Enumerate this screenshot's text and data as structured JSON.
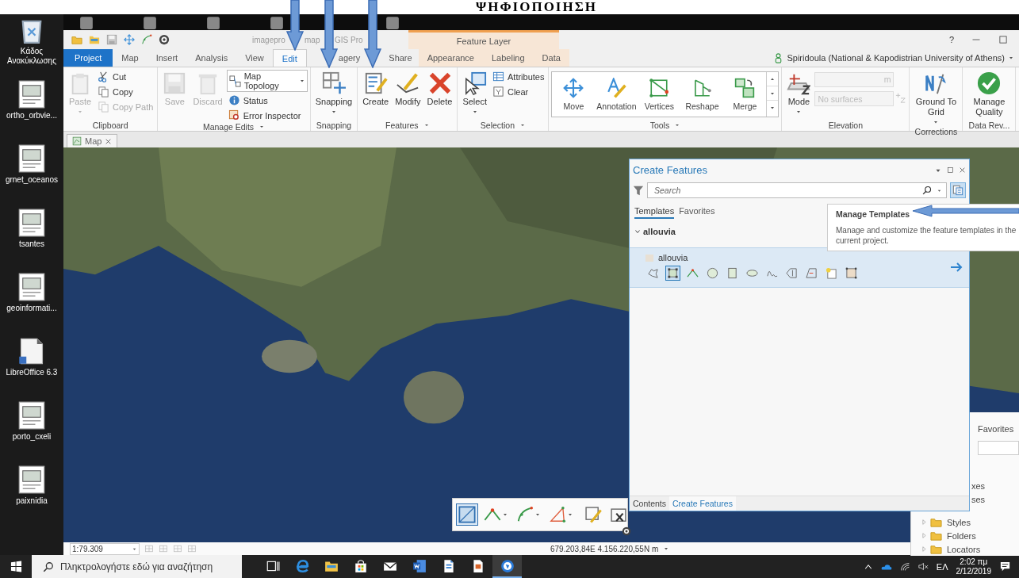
{
  "slide_title": "ΨΗΦΙΟΠΟΙΗΣΗ",
  "desktop_icons": [
    {
      "label": "Κάδος Ανακύκλωσης"
    },
    {
      "label": "ortho_orbvie..."
    },
    {
      "label": "grnet_oceanos"
    },
    {
      "label": "tsantes"
    },
    {
      "label": "geoinformati..."
    },
    {
      "label": "LibreOffice 6.3"
    },
    {
      "label": "porto_cxeli"
    },
    {
      "label": "paixnidia"
    }
  ],
  "app": {
    "title_fragments": [
      "imagepro",
      "map",
      "GIS Pro"
    ],
    "contextual_tab_group": "Feature Layer",
    "tabs": [
      {
        "label": "Project",
        "kind": "backstage",
        "selected": false
      },
      {
        "label": "Map",
        "kind": "core",
        "selected": false
      },
      {
        "label": "Insert",
        "kind": "core",
        "selected": false
      },
      {
        "label": "Analysis",
        "kind": "core",
        "selected": false
      },
      {
        "label": "View",
        "kind": "core",
        "selected": false
      },
      {
        "label": "Edit",
        "kind": "core",
        "selected": true
      },
      {
        "label": "agery",
        "kind": "core",
        "selected": false
      },
      {
        "label": "Share",
        "kind": "core",
        "selected": false
      },
      {
        "label": "Appearance",
        "kind": "contextual",
        "selected": false
      },
      {
        "label": "Labeling",
        "kind": "contextual",
        "selected": false
      },
      {
        "label": "Data",
        "kind": "contextual",
        "selected": false
      }
    ],
    "help": "?",
    "user": "Spiridoula (National & Kapodistrian University of Athens)",
    "ribbon": [
      {
        "label": "Clipboard",
        "launcher": false,
        "items": [
          {
            "kind": "large-menu",
            "label": "Paste",
            "disabled": true
          },
          {
            "kind": "small",
            "label": "Cut",
            "disabled": false
          },
          {
            "kind": "small",
            "label": "Copy",
            "disabled": false
          },
          {
            "kind": "small",
            "label": "Copy Path",
            "disabled": true
          }
        ]
      },
      {
        "label": "Manage Edits",
        "launcher": true,
        "items": [
          {
            "kind": "large",
            "label": "Save",
            "disabled": true
          },
          {
            "kind": "large",
            "label": "Discard",
            "disabled": true
          },
          {
            "kind": "combo",
            "label": "Map Topology",
            "disabled": false
          },
          {
            "kind": "small",
            "label": "Status",
            "disabled": false
          },
          {
            "kind": "small",
            "label": "Error Inspector",
            "disabled": false
          }
        ]
      },
      {
        "label": "Snapping",
        "launcher": false,
        "items": [
          {
            "kind": "large-menu",
            "label": "Snapping",
            "disabled": false
          }
        ]
      },
      {
        "label": "Features",
        "launcher": true,
        "items": [
          {
            "kind": "large",
            "label": "Create",
            "disabled": false
          },
          {
            "kind": "large",
            "label": "Modify",
            "disabled": false
          },
          {
            "kind": "large",
            "label": "Delete",
            "disabled": false
          }
        ]
      },
      {
        "label": "Selection",
        "launcher": true,
        "items": [
          {
            "kind": "large-menu",
            "label": "Select",
            "disabled": false
          },
          {
            "kind": "small",
            "label": "Attributes",
            "disabled": false
          },
          {
            "kind": "small",
            "label": "Clear",
            "disabled": false
          }
        ]
      },
      {
        "label": "Tools",
        "launcher": true,
        "items": [
          {
            "kind": "gallery",
            "disabled": false,
            "tools": [
              "Move",
              "Annotation",
              "Vertices",
              "Reshape",
              "Merge"
            ]
          }
        ]
      },
      {
        "label": "Elevation",
        "launcher": false,
        "items": [
          {
            "kind": "large-menu",
            "label": "Mode",
            "disabled": false
          },
          {
            "kind": "field",
            "unit": "m",
            "disabled": true
          },
          {
            "kind": "field",
            "placeholder": "No surfaces",
            "disabled": true
          }
        ]
      },
      {
        "label": "Corrections",
        "launcher": false,
        "items": [
          {
            "kind": "large-inline-menu",
            "label": "Ground To Grid",
            "disabled": false
          }
        ]
      },
      {
        "label": "Data Rev...",
        "launcher": false,
        "items": [
          {
            "kind": "large",
            "label": "Manage Quality",
            "disabled": false
          }
        ]
      }
    ],
    "document_tabs": [
      {
        "label": "Map",
        "selected": true
      }
    ],
    "create_features": {
      "title": "Create Features",
      "search_placeholder": "Search",
      "tabs": [
        {
          "label": "Templates",
          "selected": true
        },
        {
          "label": "Favorites",
          "selected": false
        }
      ],
      "groups": [
        {
          "name": "allouvia",
          "expanded": true,
          "templates": [
            {
              "name": "allouvia",
              "selected": true,
              "tools": [
                {
                  "selected": false
                },
                {
                  "selected": true
                },
                {
                  "selected": false
                },
                {
                  "selected": false
                },
                {
                  "selected": false
                },
                {
                  "selected": false
                },
                {
                  "selected": false
                },
                {
                  "selected": false
                },
                {
                  "selected": false
                },
                {
                  "selected": false
                },
                {
                  "selected": false
                }
              ]
            }
          ]
        }
      ],
      "bottom_tabs": [
        {
          "label": "Contents",
          "selected": false
        },
        {
          "label": "Create Features",
          "selected": true
        }
      ]
    },
    "tooltip": {
      "title": "Manage Templates",
      "text": "Manage and customize the feature templates in the current project."
    },
    "catalog": {
      "tabs": [
        "Favorites"
      ],
      "items": [
        {
          "label": "xes",
          "kind": "partial"
        },
        {
          "label": "ses",
          "kind": "partial"
        },
        {
          "label": "Styles",
          "kind": "folder"
        },
        {
          "label": "Folders",
          "kind": "folder"
        },
        {
          "label": "Locators",
          "kind": "folder"
        }
      ]
    },
    "edit_toolbar": {
      "tools": [
        {
          "selected": true
        },
        {
          "selected": false
        },
        {
          "selected": false
        },
        {
          "selected": false
        },
        {
          "selected": false
        },
        {
          "selected": false
        }
      ]
    },
    "status_bar": {
      "scale": "1:79.309",
      "coordinates": "679.203,84E 4.156.220,55N m"
    }
  },
  "taskbar": {
    "search_placeholder": "Πληκτρολογήστε εδώ για αναζήτηση",
    "apps": [
      {
        "selected": false
      },
      {
        "selected": false
      },
      {
        "selected": false
      },
      {
        "selected": false
      },
      {
        "selected": false
      },
      {
        "selected": false
      },
      {
        "selected": false
      },
      {
        "selected": false
      },
      {
        "selected": true
      }
    ],
    "language": "ΕΛ",
    "time": "2:02 πμ",
    "date": "2/12/2019"
  }
}
